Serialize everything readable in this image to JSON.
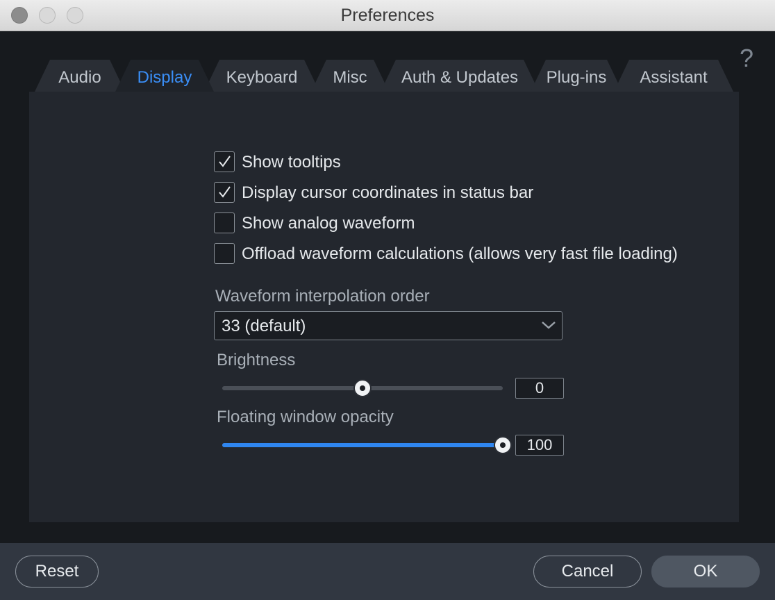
{
  "window": {
    "title": "Preferences"
  },
  "help": {
    "symbol": "?"
  },
  "tabs": [
    {
      "label": "Audio",
      "active": false
    },
    {
      "label": "Display",
      "active": true
    },
    {
      "label": "Keyboard",
      "active": false
    },
    {
      "label": "Misc",
      "active": false
    },
    {
      "label": "Auth & Updates",
      "active": false
    },
    {
      "label": "Plug-ins",
      "active": false
    },
    {
      "label": "Assistant",
      "active": false
    }
  ],
  "display": {
    "checkboxes": [
      {
        "label": "Show tooltips",
        "checked": true
      },
      {
        "label": "Display cursor coordinates in status bar",
        "checked": true
      },
      {
        "label": "Show analog waveform",
        "checked": false
      },
      {
        "label": "Offload waveform calculations (allows very fast file loading)",
        "checked": false
      }
    ],
    "interpolation": {
      "label": "Waveform interpolation order",
      "value": "33 (default)"
    },
    "brightness": {
      "label": "Brightness",
      "value": "0",
      "fraction": 0.5
    },
    "opacity": {
      "label": "Floating window opacity",
      "value": "100",
      "fraction": 1.0
    }
  },
  "footer": {
    "reset": "Reset",
    "cancel": "Cancel",
    "ok": "OK"
  },
  "colors": {
    "accent": "#3a8ef6",
    "panel": "#23272e",
    "footer": "#313741"
  }
}
